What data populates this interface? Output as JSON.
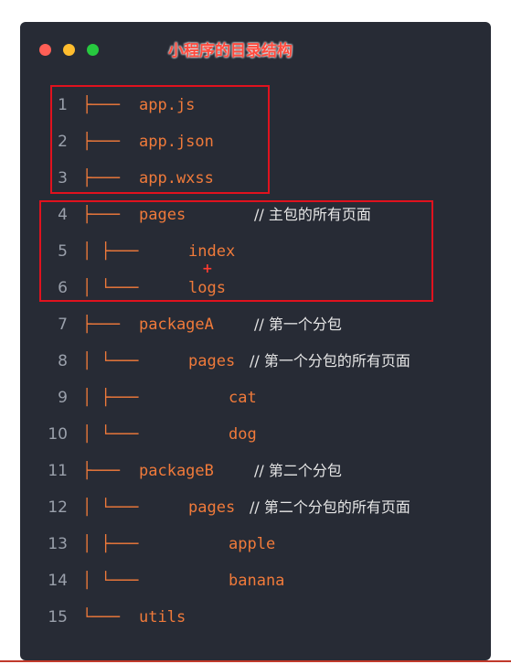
{
  "window": {
    "title": "小程序的目录结构",
    "controls": [
      "close-dot",
      "minimize-dot",
      "maximize-dot"
    ]
  },
  "lines": [
    {
      "num": "1",
      "branch": "├───",
      "name": "app.js",
      "comment": ""
    },
    {
      "num": "2",
      "branch": "├───",
      "name": "app.json",
      "comment": ""
    },
    {
      "num": "3",
      "branch": "├───",
      "name": "app.wxss",
      "comment": ""
    },
    {
      "num": "4",
      "branch": "├───",
      "name": "pages",
      "comment": "// 主包的所有页面"
    },
    {
      "num": "5",
      "branch": "│    ├───",
      "name": "index",
      "comment": ""
    },
    {
      "num": "6",
      "branch": "│    └───",
      "name": "logs",
      "comment": ""
    },
    {
      "num": "7",
      "branch": "├───",
      "name": "packageA",
      "comment": "// 第一个分包"
    },
    {
      "num": "8",
      "branch": "│    └───",
      "name": "pages",
      "comment": "// 第一个分包的所有页面"
    },
    {
      "num": "9",
      "branch": "│        ├───",
      "name": "cat",
      "comment": ""
    },
    {
      "num": "10",
      "branch": "│        └───",
      "name": "dog",
      "comment": ""
    },
    {
      "num": "11",
      "branch": "├───",
      "name": "packageB",
      "comment": "// 第二个分包"
    },
    {
      "num": "12",
      "branch": "│    └───",
      "name": "pages",
      "comment": "// 第二个分包的所有页面"
    },
    {
      "num": "13",
      "branch": "│        ├───",
      "name": "apple",
      "comment": ""
    },
    {
      "num": "14",
      "branch": "│        └───",
      "name": "banana",
      "comment": ""
    },
    {
      "num": "15",
      "branch": "└───",
      "name": "utils",
      "comment": ""
    }
  ],
  "annotations": {
    "plus": "+"
  },
  "colors": {
    "background": "#272b35",
    "tree": "#f07a3a",
    "highlight_box": "#e0121e",
    "title": "#ff4a3d"
  }
}
